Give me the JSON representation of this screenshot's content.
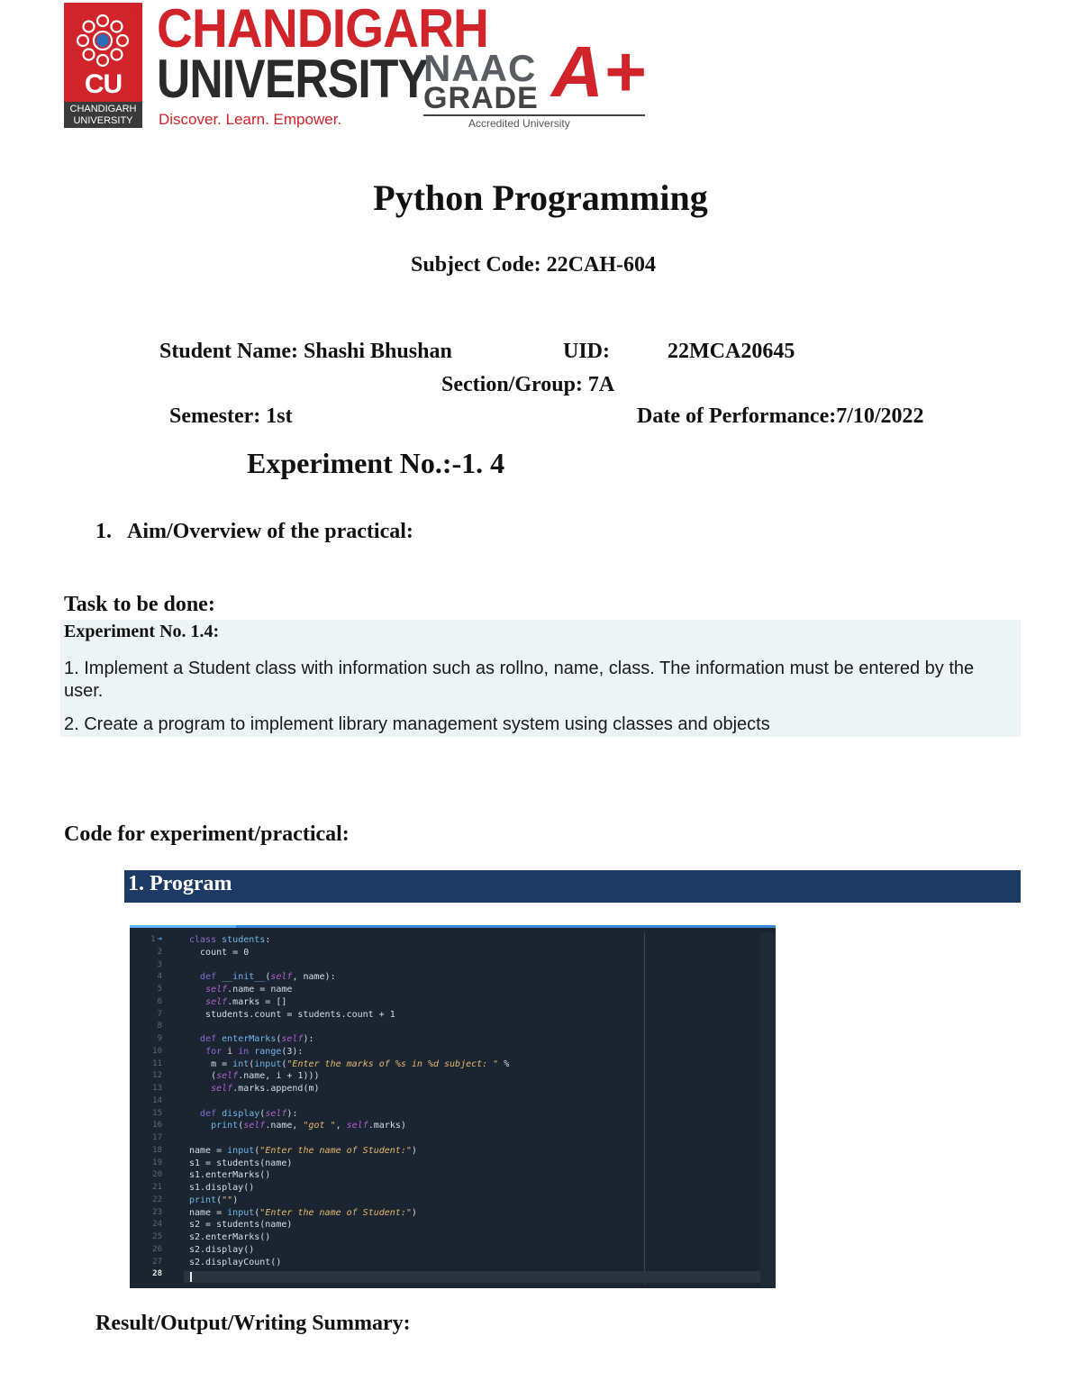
{
  "header": {
    "logo_initials": "CU",
    "logo_band": [
      "CHANDIGARH",
      "UNIVERSITY"
    ],
    "brand_line1": "CHANDIGARH",
    "brand_line2": "UNIVERSITY",
    "tagline": "Discover. Learn. Empower.",
    "naac": "NAAC",
    "grade": "GRADE",
    "grade_value": "A+",
    "accredited": "Accredited University",
    "brand_color": "#d0232a"
  },
  "document": {
    "title": "Python Programming",
    "subject_code": "Subject Code: 22CAH-604",
    "student_name": "Student Name: Shashi Bhushan",
    "uid_label": "UID:",
    "uid_value": "22MCA20645",
    "section": "Section/Group: 7A",
    "semester": "Semester: 1st",
    "date": "Date of Performance:7/10/2022",
    "experiment_title": "Experiment No.:-1. 4",
    "aim_number": "1.",
    "aim_label": "Aim/Overview of the practical:",
    "task_label": "Task to be done:",
    "task_box": {
      "heading": "Experiment No. 1.4:",
      "items": [
        "1. Implement a Student class with information such as rollno, name, class. The information must be entered by the user.",
        "2. Create a program to implement library management system using classes and objects"
      ]
    },
    "code_label": "Code for experiment/practical:",
    "program_bar": "1.  Program",
    "program_bar_color": "#1c3a63",
    "result_label": "Result/Output/Writing Summary:"
  },
  "editor": {
    "current_line": "28",
    "line_numbers": [
      "1",
      "2",
      "3",
      "4",
      "5",
      "6",
      "7",
      "8",
      "9",
      "10",
      "11",
      "12",
      "13",
      "14",
      "15",
      "16",
      "17",
      "18",
      "19",
      "20",
      "21",
      "22",
      "23",
      "24",
      "25",
      "26",
      "27",
      "28"
    ]
  }
}
